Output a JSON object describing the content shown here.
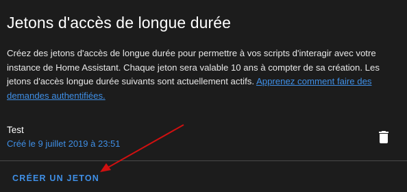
{
  "section": {
    "title": "Jetons d'accès de longue durée",
    "description_text": "Créez des jetons d'accès de longue durée pour permettre à vos scripts d'interagir avec votre instance de Home Assistant. Chaque jeton sera valable 10 ans à compter de sa création. Les jetons d'accès longue durée suivants sont actuellement actifs. ",
    "learn_more_link": "Apprenez comment faire des demandes authentifiées."
  },
  "tokens": [
    {
      "name": "Test",
      "created": "Créé le 9 juillet 2019 à 23:51",
      "delete_icon": "trash-icon"
    }
  ],
  "actions": {
    "create_label": "CRÉER UN JETON"
  },
  "annotation": {
    "arrow_color": "#d01010"
  },
  "colors": {
    "accent": "#3f8fe6",
    "background": "#1c1c1c"
  }
}
